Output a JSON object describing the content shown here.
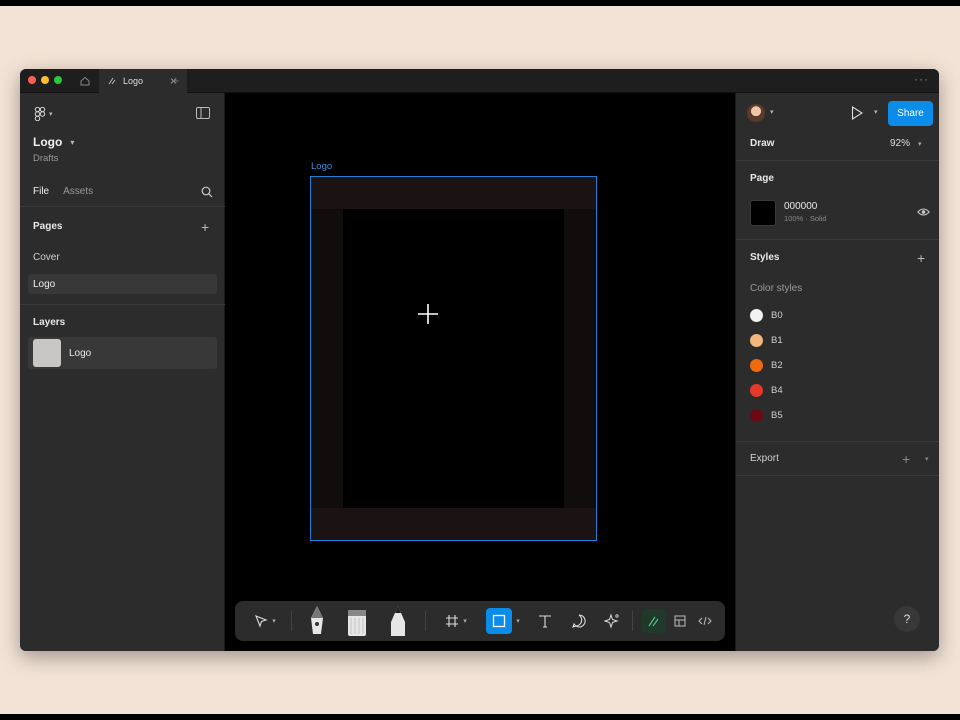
{
  "titlebar": {
    "tab_label": "Logo",
    "tab_close": "×",
    "tab_add": "+",
    "more": "···"
  },
  "left_panel": {
    "file_name": "Logo",
    "file_location": "Drafts",
    "tabs": {
      "file": "File",
      "assets": "Assets"
    },
    "pages_header": "Pages",
    "pages": [
      {
        "label": "Cover",
        "selected": false
      },
      {
        "label": "Logo",
        "selected": true
      }
    ],
    "layers_header": "Layers",
    "layers": [
      {
        "label": "Logo"
      }
    ]
  },
  "canvas": {
    "frame_label": "Logo",
    "background": "#000000",
    "frame_selection_color": "#1f7ed6"
  },
  "toolbar": {
    "tools": [
      "move-tool",
      "pen-tool",
      "marker-tool",
      "pencil-tool",
      "frame-tool",
      "shape-tool",
      "text-tool",
      "comment-tool",
      "actions-tool",
      "draw-mode",
      "design-mode",
      "dev-mode"
    ],
    "active_tool": "shape-tool"
  },
  "right_panel": {
    "share_label": "Share",
    "mode_label": "Draw",
    "zoom": "92%",
    "page_header": "Page",
    "page_color": {
      "hex": "000000",
      "meta": "100%  ·  Solid",
      "swatch": "#000000"
    },
    "styles_header": "Styles",
    "color_styles_label": "Color styles",
    "color_styles": [
      {
        "name": "B0",
        "color": "#f2f2f2"
      },
      {
        "name": "B1",
        "color": "#f2b77a"
      },
      {
        "name": "B2",
        "color": "#f06a0e"
      },
      {
        "name": "B4",
        "color": "#e53a2a"
      },
      {
        "name": "B5",
        "color": "#6b0a12"
      }
    ],
    "export_header": "Export",
    "help": "?"
  },
  "colors": {
    "accent": "#0c8ce9",
    "panel": "#2c2c2c",
    "outer_background": "#f3e3d6"
  }
}
